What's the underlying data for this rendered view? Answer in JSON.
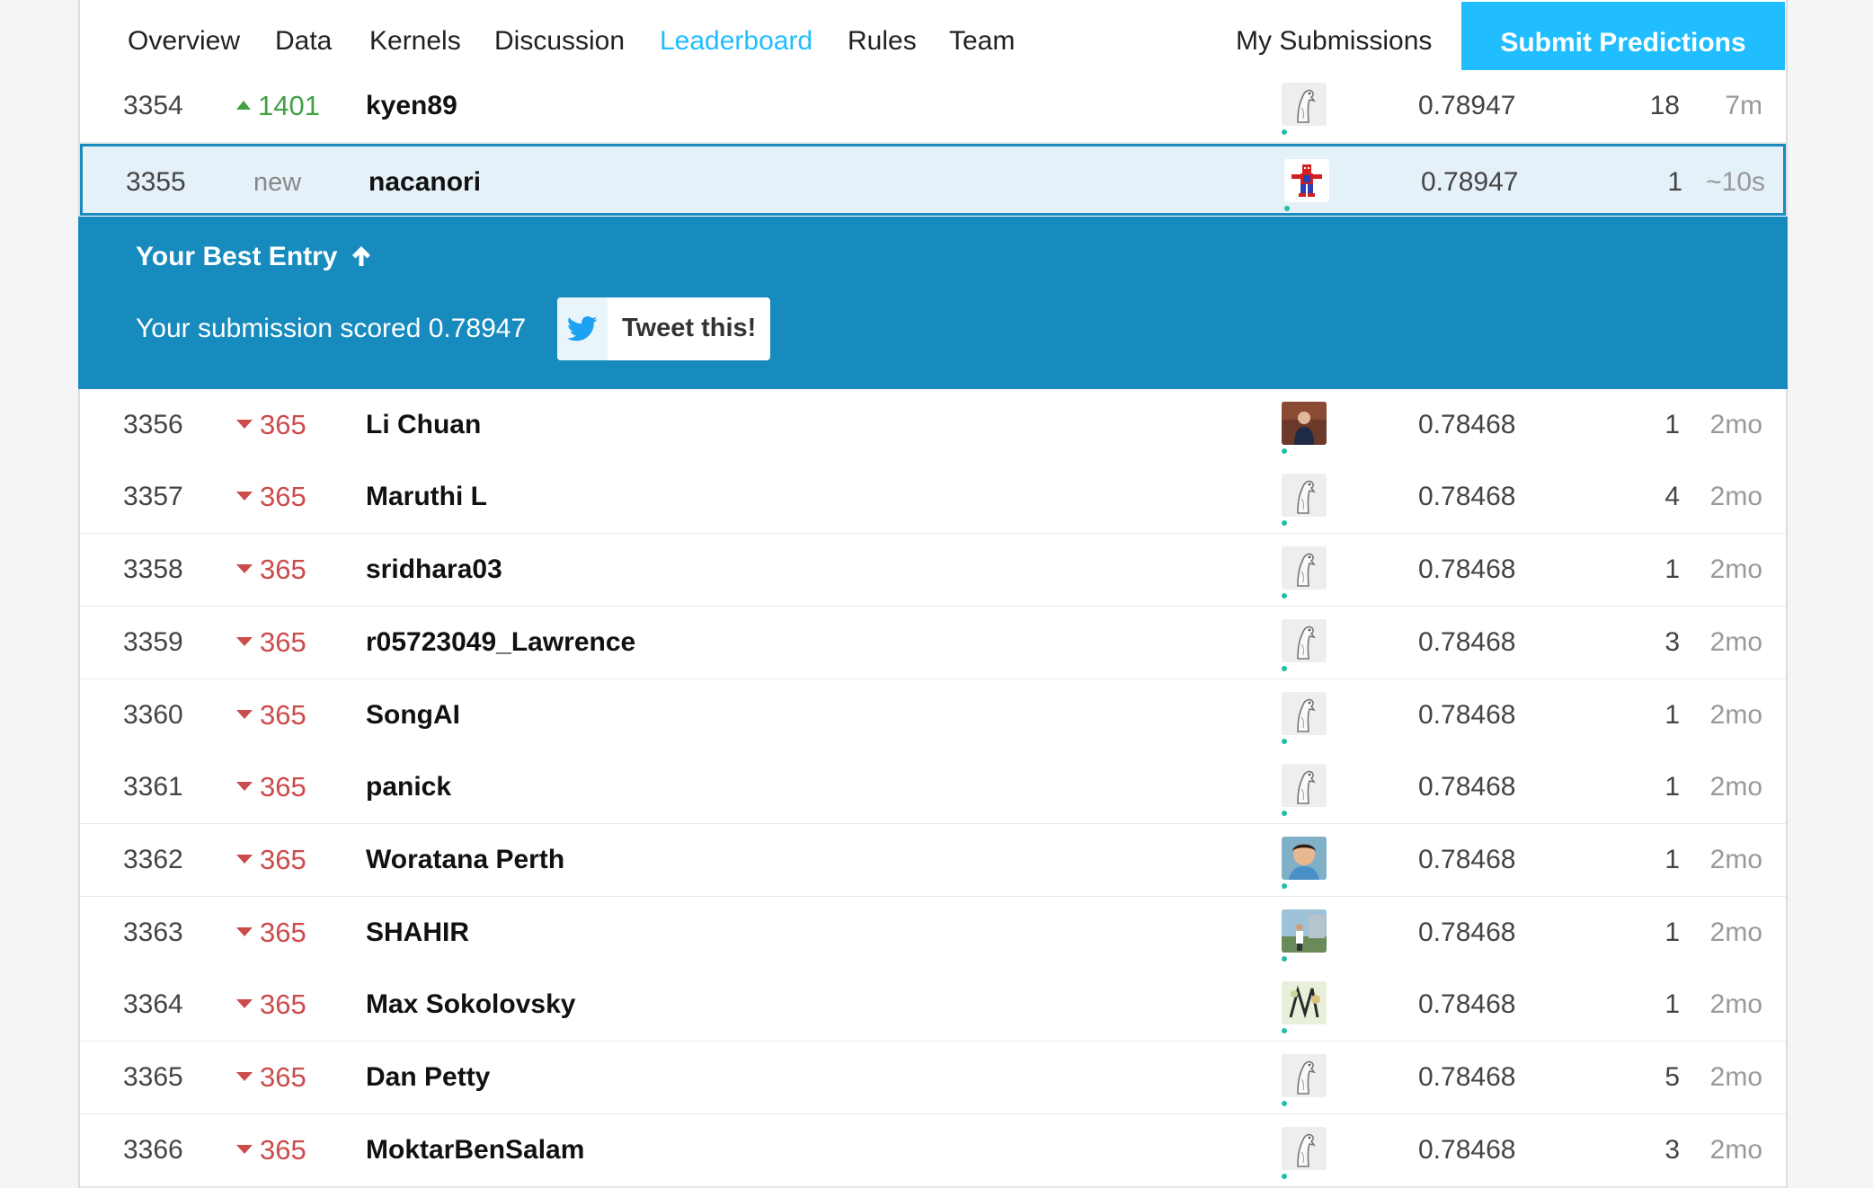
{
  "nav": {
    "tabs": [
      "Overview",
      "Data",
      "Kernels",
      "Discussion",
      "Leaderboard",
      "Rules",
      "Team"
    ],
    "active_tab": "Leaderboard",
    "my_submissions": "My Submissions",
    "submit_predictions": "Submit Predictions"
  },
  "best_entry": {
    "title": "Your Best Entry",
    "message": "Your submission scored 0.78947",
    "tweet_label": "Tweet this!"
  },
  "leaderboard": [
    {
      "rank": "3354",
      "change": "1401",
      "change_dir": "up",
      "name": "kyen89",
      "score": "0.78947",
      "entries": "18",
      "last": "7m",
      "avatar": "default-duck"
    },
    {
      "rank": "3355",
      "change": "new",
      "change_dir": "new",
      "name": "nacanori",
      "score": "0.78947",
      "entries": "1",
      "last": "~10s",
      "avatar": "spiderman-pixel"
    },
    {
      "rank": "3356",
      "change": "365",
      "change_dir": "down",
      "name": "Li Chuan",
      "score": "0.78468",
      "entries": "1",
      "last": "2mo",
      "avatar": "photo-person"
    },
    {
      "rank": "3357",
      "change": "365",
      "change_dir": "down",
      "name": "Maruthi L",
      "score": "0.78468",
      "entries": "4",
      "last": "2mo",
      "avatar": "default-duck"
    },
    {
      "rank": "3358",
      "change": "365",
      "change_dir": "down",
      "name": "sridhara03",
      "score": "0.78468",
      "entries": "1",
      "last": "2mo",
      "avatar": "default-duck"
    },
    {
      "rank": "3359",
      "change": "365",
      "change_dir": "down",
      "name": "r05723049_Lawrence",
      "score": "0.78468",
      "entries": "3",
      "last": "2mo",
      "avatar": "default-duck"
    },
    {
      "rank": "3360",
      "change": "365",
      "change_dir": "down",
      "name": "SongAI",
      "score": "0.78468",
      "entries": "1",
      "last": "2mo",
      "avatar": "default-duck"
    },
    {
      "rank": "3361",
      "change": "365",
      "change_dir": "down",
      "name": "panick",
      "score": "0.78468",
      "entries": "1",
      "last": "2mo",
      "avatar": "default-duck"
    },
    {
      "rank": "3362",
      "change": "365",
      "change_dir": "down",
      "name": "Woratana Perth",
      "score": "0.78468",
      "entries": "1",
      "last": "2mo",
      "avatar": "photo-face"
    },
    {
      "rank": "3363",
      "change": "365",
      "change_dir": "down",
      "name": "SHAHIR",
      "score": "0.78468",
      "entries": "1",
      "last": "2mo",
      "avatar": "photo-outdoor"
    },
    {
      "rank": "3364",
      "change": "365",
      "change_dir": "down",
      "name": "Max Sokolovsky",
      "score": "0.78468",
      "entries": "1",
      "last": "2mo",
      "avatar": "photo-drawing"
    },
    {
      "rank": "3365",
      "change": "365",
      "change_dir": "down",
      "name": "Dan Petty",
      "score": "0.78468",
      "entries": "5",
      "last": "2mo",
      "avatar": "default-duck"
    },
    {
      "rank": "3366",
      "change": "365",
      "change_dir": "down",
      "name": "MoktarBenSalam",
      "score": "0.78468",
      "entries": "3",
      "last": "2mo",
      "avatar": "default-duck"
    }
  ],
  "colors": {
    "accent": "#20beff",
    "banner": "#178bbe",
    "up": "#43a047",
    "down": "#cc4b4b"
  }
}
